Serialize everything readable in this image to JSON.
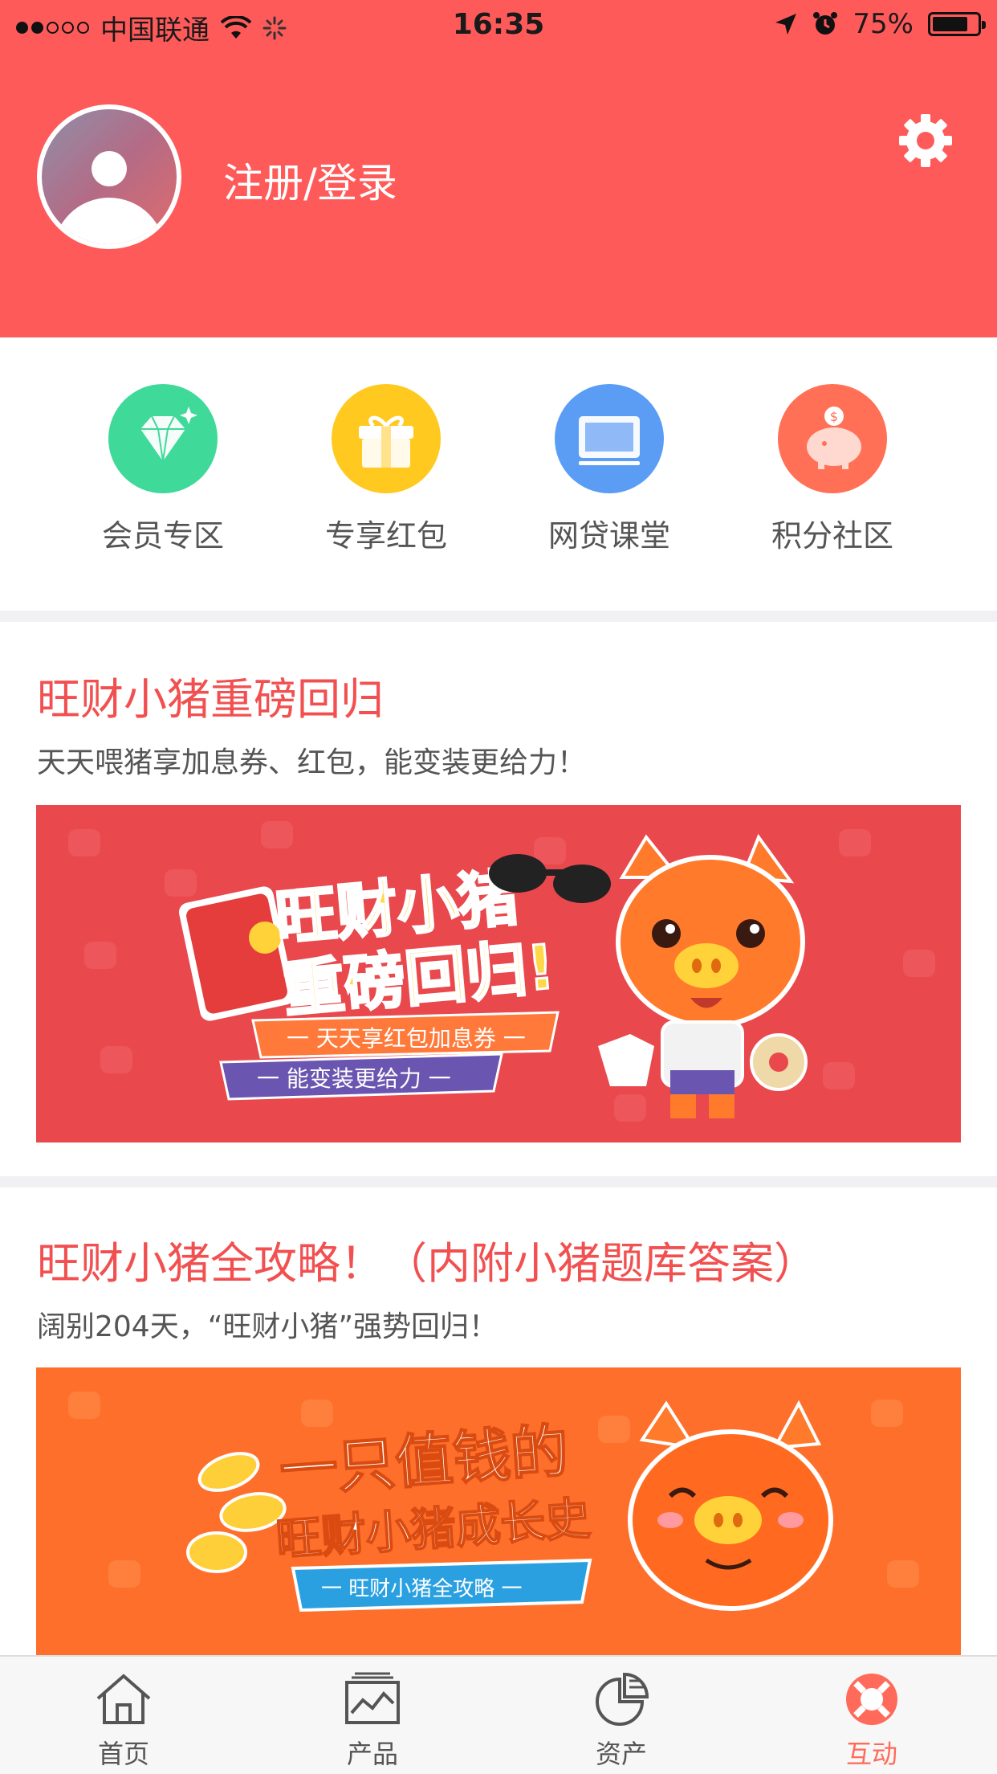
{
  "status_bar": {
    "carrier": "中国联通",
    "time": "16:35",
    "battery": "75%",
    "battery_level": 0.75
  },
  "header": {
    "login_label": "注册/登录",
    "settings_icon": "gear-icon",
    "background_color": "#ff5a5a"
  },
  "shortcuts": [
    {
      "label": "会员专区",
      "icon": "diamond-icon",
      "color": "#3fd99a"
    },
    {
      "label": "专享红包",
      "icon": "gift-icon",
      "color": "#ffc91f"
    },
    {
      "label": "网贷课堂",
      "icon": "screen-icon",
      "color": "#5b9df5"
    },
    {
      "label": "积分社区",
      "icon": "piggy-bank-icon",
      "color": "#ff7056"
    }
  ],
  "articles": [
    {
      "title": "旺财小猪重磅回归",
      "subtitle": "天天喂猪享加息券、红包，能变装更给力！",
      "banner": {
        "headline_1": "旺财小猪",
        "headline_2": "重磅回归!",
        "ribbon_1": "一 天天享红包加息券 一",
        "ribbon_2": "一 能变装更给力 一",
        "background_color": "#e9484d"
      }
    },
    {
      "title": "旺财小猪全攻略！（内附小猪题库答案）",
      "subtitle": "阔别204天，“旺财小猪”强势回归！",
      "banner": {
        "headline_1": "一只值钱的",
        "headline_2": "旺财小猪成长史",
        "ribbon_1": "一 旺财小猪全攻略 一",
        "background_color": "#ff6f2c"
      }
    }
  ],
  "tabbar": [
    {
      "label": "首页",
      "icon": "home-icon",
      "active": false
    },
    {
      "label": "产品",
      "icon": "chart-icon",
      "active": false
    },
    {
      "label": "资产",
      "icon": "pie-chart-icon",
      "active": false
    },
    {
      "label": "互动",
      "icon": "lifebuoy-icon",
      "active": true
    }
  ],
  "accent_color": "#ff6a5a"
}
